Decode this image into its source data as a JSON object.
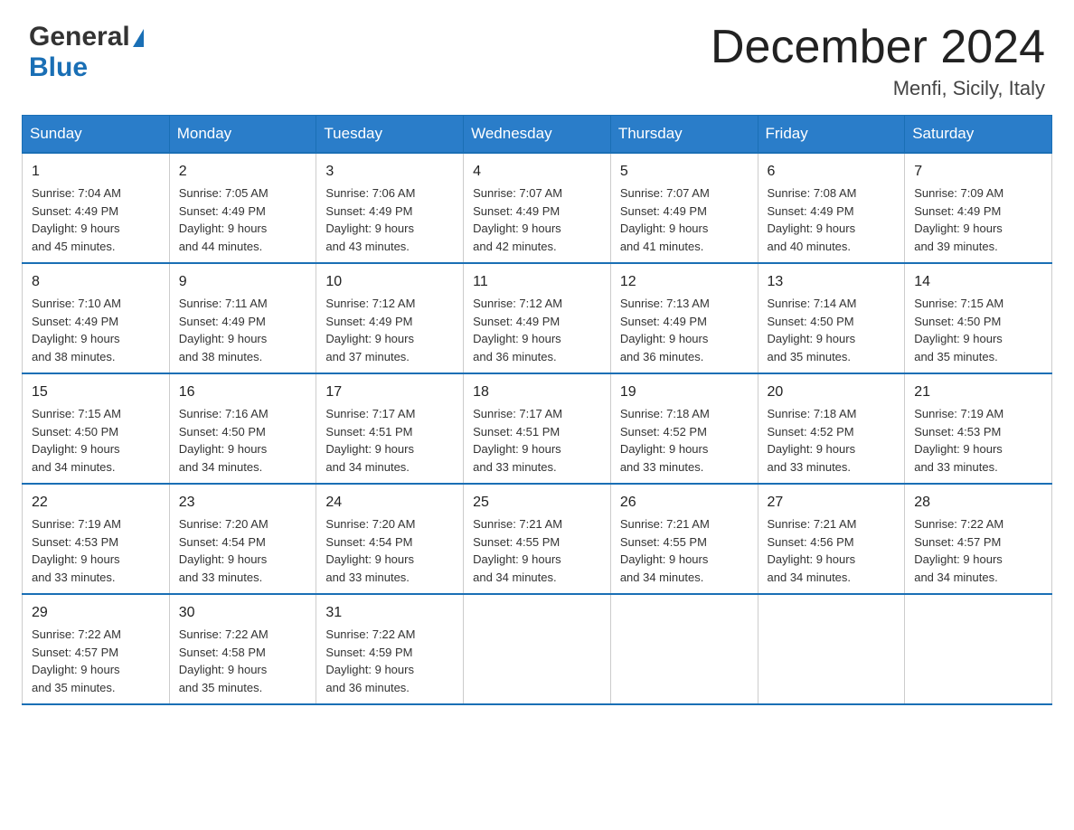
{
  "logo": {
    "general": "General",
    "blue": "Blue",
    "triangle": "▶"
  },
  "header": {
    "month": "December 2024",
    "location": "Menfi, Sicily, Italy"
  },
  "weekdays": [
    "Sunday",
    "Monday",
    "Tuesday",
    "Wednesday",
    "Thursday",
    "Friday",
    "Saturday"
  ],
  "weeks": [
    [
      {
        "day": "1",
        "info": "Sunrise: 7:04 AM\nSunset: 4:49 PM\nDaylight: 9 hours\nand 45 minutes."
      },
      {
        "day": "2",
        "info": "Sunrise: 7:05 AM\nSunset: 4:49 PM\nDaylight: 9 hours\nand 44 minutes."
      },
      {
        "day": "3",
        "info": "Sunrise: 7:06 AM\nSunset: 4:49 PM\nDaylight: 9 hours\nand 43 minutes."
      },
      {
        "day": "4",
        "info": "Sunrise: 7:07 AM\nSunset: 4:49 PM\nDaylight: 9 hours\nand 42 minutes."
      },
      {
        "day": "5",
        "info": "Sunrise: 7:07 AM\nSunset: 4:49 PM\nDaylight: 9 hours\nand 41 minutes."
      },
      {
        "day": "6",
        "info": "Sunrise: 7:08 AM\nSunset: 4:49 PM\nDaylight: 9 hours\nand 40 minutes."
      },
      {
        "day": "7",
        "info": "Sunrise: 7:09 AM\nSunset: 4:49 PM\nDaylight: 9 hours\nand 39 minutes."
      }
    ],
    [
      {
        "day": "8",
        "info": "Sunrise: 7:10 AM\nSunset: 4:49 PM\nDaylight: 9 hours\nand 38 minutes."
      },
      {
        "day": "9",
        "info": "Sunrise: 7:11 AM\nSunset: 4:49 PM\nDaylight: 9 hours\nand 38 minutes."
      },
      {
        "day": "10",
        "info": "Sunrise: 7:12 AM\nSunset: 4:49 PM\nDaylight: 9 hours\nand 37 minutes."
      },
      {
        "day": "11",
        "info": "Sunrise: 7:12 AM\nSunset: 4:49 PM\nDaylight: 9 hours\nand 36 minutes."
      },
      {
        "day": "12",
        "info": "Sunrise: 7:13 AM\nSunset: 4:49 PM\nDaylight: 9 hours\nand 36 minutes."
      },
      {
        "day": "13",
        "info": "Sunrise: 7:14 AM\nSunset: 4:50 PM\nDaylight: 9 hours\nand 35 minutes."
      },
      {
        "day": "14",
        "info": "Sunrise: 7:15 AM\nSunset: 4:50 PM\nDaylight: 9 hours\nand 35 minutes."
      }
    ],
    [
      {
        "day": "15",
        "info": "Sunrise: 7:15 AM\nSunset: 4:50 PM\nDaylight: 9 hours\nand 34 minutes."
      },
      {
        "day": "16",
        "info": "Sunrise: 7:16 AM\nSunset: 4:50 PM\nDaylight: 9 hours\nand 34 minutes."
      },
      {
        "day": "17",
        "info": "Sunrise: 7:17 AM\nSunset: 4:51 PM\nDaylight: 9 hours\nand 34 minutes."
      },
      {
        "day": "18",
        "info": "Sunrise: 7:17 AM\nSunset: 4:51 PM\nDaylight: 9 hours\nand 33 minutes."
      },
      {
        "day": "19",
        "info": "Sunrise: 7:18 AM\nSunset: 4:52 PM\nDaylight: 9 hours\nand 33 minutes."
      },
      {
        "day": "20",
        "info": "Sunrise: 7:18 AM\nSunset: 4:52 PM\nDaylight: 9 hours\nand 33 minutes."
      },
      {
        "day": "21",
        "info": "Sunrise: 7:19 AM\nSunset: 4:53 PM\nDaylight: 9 hours\nand 33 minutes."
      }
    ],
    [
      {
        "day": "22",
        "info": "Sunrise: 7:19 AM\nSunset: 4:53 PM\nDaylight: 9 hours\nand 33 minutes."
      },
      {
        "day": "23",
        "info": "Sunrise: 7:20 AM\nSunset: 4:54 PM\nDaylight: 9 hours\nand 33 minutes."
      },
      {
        "day": "24",
        "info": "Sunrise: 7:20 AM\nSunset: 4:54 PM\nDaylight: 9 hours\nand 33 minutes."
      },
      {
        "day": "25",
        "info": "Sunrise: 7:21 AM\nSunset: 4:55 PM\nDaylight: 9 hours\nand 34 minutes."
      },
      {
        "day": "26",
        "info": "Sunrise: 7:21 AM\nSunset: 4:55 PM\nDaylight: 9 hours\nand 34 minutes."
      },
      {
        "day": "27",
        "info": "Sunrise: 7:21 AM\nSunset: 4:56 PM\nDaylight: 9 hours\nand 34 minutes."
      },
      {
        "day": "28",
        "info": "Sunrise: 7:22 AM\nSunset: 4:57 PM\nDaylight: 9 hours\nand 34 minutes."
      }
    ],
    [
      {
        "day": "29",
        "info": "Sunrise: 7:22 AM\nSunset: 4:57 PM\nDaylight: 9 hours\nand 35 minutes."
      },
      {
        "day": "30",
        "info": "Sunrise: 7:22 AM\nSunset: 4:58 PM\nDaylight: 9 hours\nand 35 minutes."
      },
      {
        "day": "31",
        "info": "Sunrise: 7:22 AM\nSunset: 4:59 PM\nDaylight: 9 hours\nand 36 minutes."
      },
      null,
      null,
      null,
      null
    ]
  ]
}
